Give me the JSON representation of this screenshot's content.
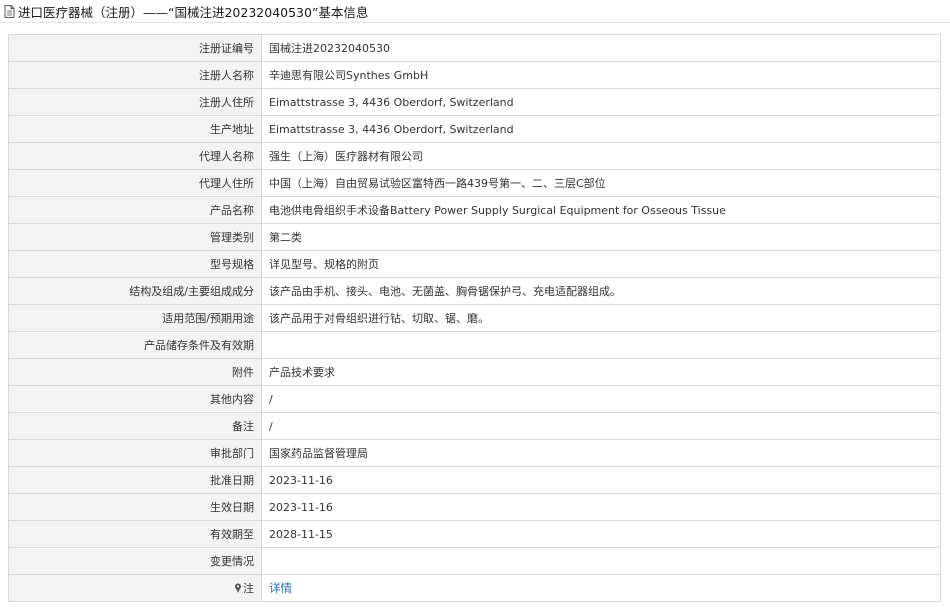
{
  "header": {
    "title": "进口医疗器械（注册）——“国械注进20232040530”基本信息"
  },
  "rows": [
    {
      "label": "注册证编号",
      "value": "国械注进20232040530"
    },
    {
      "label": "注册人名称",
      "value": "辛迪思有限公司Synthes GmbH"
    },
    {
      "label": "注册人住所",
      "value": "Eimattstrasse 3, 4436 Oberdorf, Switzerland"
    },
    {
      "label": "生产地址",
      "value": "Eimattstrasse 3, 4436 Oberdorf, Switzerland"
    },
    {
      "label": "代理人名称",
      "value": "强生（上海）医疗器材有限公司"
    },
    {
      "label": "代理人住所",
      "value": "中国（上海）自由贸易试验区富特西一路439号第一、二、三层C部位"
    },
    {
      "label": "产品名称",
      "value": "电池供电骨组织手术设备Battery Power Supply Surgical Equipment for Osseous Tissue"
    },
    {
      "label": "管理类别",
      "value": "第二类"
    },
    {
      "label": "型号规格",
      "value": "详见型号、规格的附页"
    },
    {
      "label": "结构及组成/主要组成成分",
      "value": "该产品由手机、接头、电池、无菌盖、胸骨锯保护弓、充电适配器组成。"
    },
    {
      "label": "适用范围/预期用途",
      "value": "该产品用于对骨组织进行钻、切取、锯、磨。"
    },
    {
      "label": "产品储存条件及有效期",
      "value": ""
    },
    {
      "label": "附件",
      "value": "产品技术要求"
    },
    {
      "label": "其他内容",
      "value": "/"
    },
    {
      "label": "备注",
      "value": "/"
    },
    {
      "label": "审批部门",
      "value": "国家药品监督管理局"
    },
    {
      "label": "批准日期",
      "value": "2023-11-16"
    },
    {
      "label": "生效日期",
      "value": "2023-11-16"
    },
    {
      "label": "有效期至",
      "value": "2028-11-15"
    },
    {
      "label": "变更情况",
      "value": ""
    }
  ],
  "note_row": {
    "label": "注",
    "link_text": "详情"
  }
}
